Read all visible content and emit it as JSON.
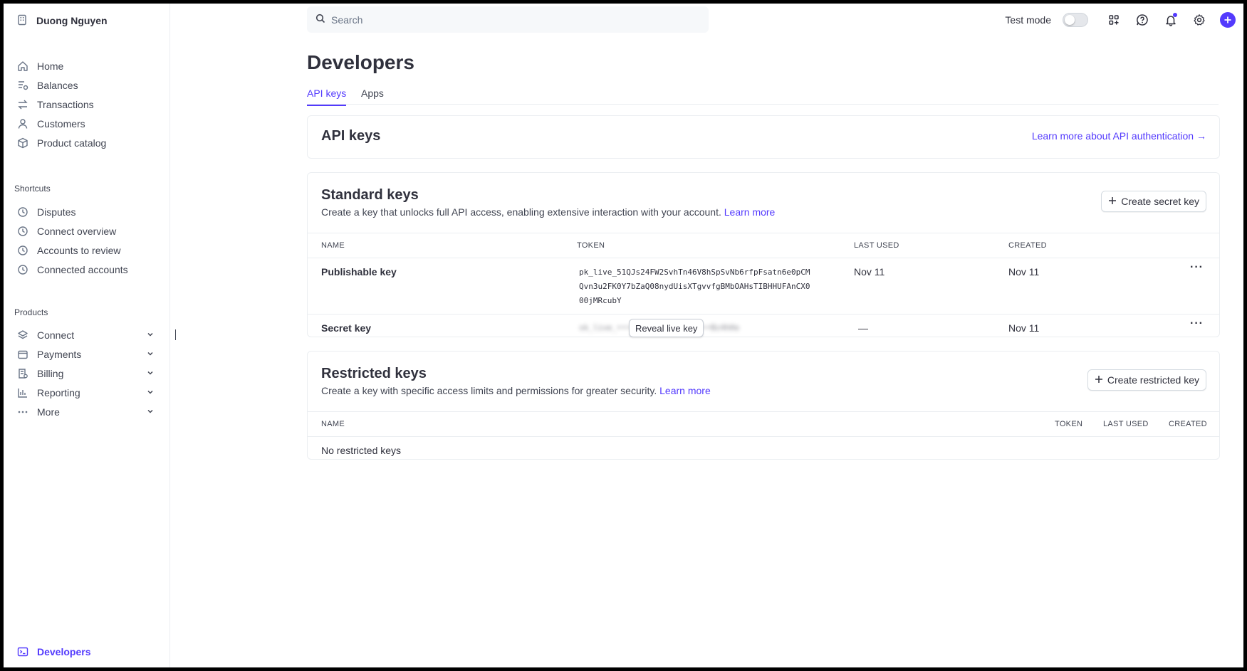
{
  "account": {
    "name": "Duong Nguyen"
  },
  "sidebar": {
    "main_items": [
      {
        "label": "Home",
        "icon": "home-icon"
      },
      {
        "label": "Balances",
        "icon": "balances-icon"
      },
      {
        "label": "Transactions",
        "icon": "transactions-icon"
      },
      {
        "label": "Customers",
        "icon": "customer-icon"
      },
      {
        "label": "Product catalog",
        "icon": "box-icon"
      }
    ],
    "shortcuts_label": "Shortcuts",
    "shortcuts": [
      {
        "label": "Disputes",
        "icon": "clock-icon"
      },
      {
        "label": "Connect overview",
        "icon": "clock-icon"
      },
      {
        "label": "Accounts to review",
        "icon": "clock-icon"
      },
      {
        "label": "Connected accounts",
        "icon": "clock-icon"
      }
    ],
    "products_label": "Products",
    "products": [
      {
        "label": "Connect",
        "icon": "layers-icon"
      },
      {
        "label": "Payments",
        "icon": "wallet-icon"
      },
      {
        "label": "Billing",
        "icon": "billing-icon"
      },
      {
        "label": "Reporting",
        "icon": "bar-chart-icon"
      },
      {
        "label": "More",
        "icon": "more-icon"
      }
    ],
    "developers": "Developers"
  },
  "topbar": {
    "search_placeholder": "Search",
    "test_mode_label": "Test mode",
    "accent": "#533afd"
  },
  "page": {
    "title": "Developers",
    "tabs": [
      "API keys",
      "Apps"
    ]
  },
  "api_keys_card": {
    "title": "API keys",
    "learn_link": "Learn more about API authentication →"
  },
  "standard_keys": {
    "title": "Standard keys",
    "description": "Create a key that unlocks full API access, enabling extensive interaction with your account.",
    "learn_more": "Learn more",
    "create_button": "Create secret key",
    "columns": [
      "NAME",
      "TOKEN",
      "LAST USED",
      "CREATED"
    ],
    "rows": [
      {
        "name": "Publishable key",
        "token": "pk_live_51QJs24FW2SvhTn46V8hSpSvNb6rfpFsatn6e0pCMQvn3u2FK0Y7bZaQ08nydUisXTgvvfgBMbOAHsTIBHHUFAnCX000jMRcubY",
        "last_used": "Nov 11",
        "created": "Nov 11"
      },
      {
        "name": "Secret key",
        "token_masked": "sk_live_••••••••••••••••••••Bz4hHo",
        "reveal_label": "Reveal live key",
        "last_used": "—",
        "created": "Nov 11"
      }
    ]
  },
  "restricted_keys": {
    "title": "Restricted keys",
    "description": "Create a key with specific access limits and permissions for greater security.",
    "learn_more": "Learn more",
    "create_button": "Create restricted key",
    "columns": [
      "NAME",
      "TOKEN",
      "LAST USED",
      "CREATED"
    ],
    "empty_text": "No restricted keys"
  }
}
